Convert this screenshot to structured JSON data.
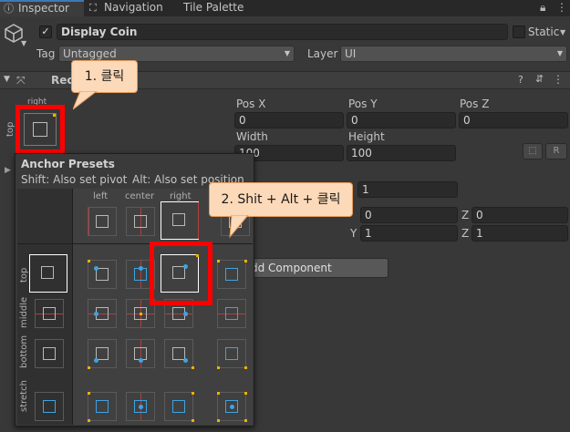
{
  "tabs": [
    {
      "label": "Inspector",
      "icon": "info-icon"
    },
    {
      "label": "Navigation",
      "icon": "navigation-icon"
    },
    {
      "label": "Tile Palette",
      "icon": ""
    }
  ],
  "object": {
    "name": "Display Coin",
    "static_label": "Static",
    "tag_label": "Tag",
    "tag_value": "Untagged",
    "layer_label": "Layer",
    "layer_value": "UI"
  },
  "rect_transform": {
    "title": "Rec",
    "anchor_h": "right",
    "anchor_v": "top",
    "pos_x_label": "Pos X",
    "pos_y_label": "Pos Y",
    "pos_z_label": "Pos Z",
    "pos_x": "0",
    "pos_y": "0",
    "pos_z": "0",
    "width_label": "Width",
    "height_label": "Height",
    "width": "100",
    "height": "100",
    "r_button": "R",
    "pivot_y": "1",
    "rot_x_value": "0",
    "rot_y_label": "Y",
    "rot_z_label": "Z",
    "rot_z_value": "0",
    "scale_y_label": "Y",
    "scale_y_value": "1",
    "scale_z_label": "Z",
    "scale_z_value": "1",
    "add_component": "dd Component"
  },
  "anchor_presets": {
    "title": "Anchor Presets",
    "hint_pivot": "Shift: Also set pivot",
    "hint_position": "Alt: Also set position",
    "columns": [
      "left",
      "center",
      "right"
    ],
    "rows": [
      "top",
      "middle",
      "bottom",
      "stretch"
    ]
  },
  "callouts": {
    "step1": "1. 클릭",
    "step2": "2. Shit + Alt + 클릭"
  },
  "colors": {
    "highlight": "#ff0000",
    "callout_bg": "#fcd9b8",
    "anchor_dot": "#3fa3e2",
    "pivot_dot": "#f0b000"
  }
}
